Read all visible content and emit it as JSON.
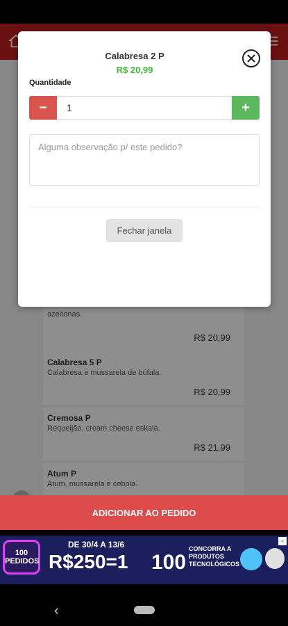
{
  "modal": {
    "title": "Calabresa 2 P",
    "price": "R$ 20,99",
    "quantity_label": "Quantidade",
    "quantity_value": "1",
    "minus_label": "−",
    "plus_label": "+",
    "observation_placeholder": "Alguma observação p/ este pedido?",
    "close_button_label": "Fechar janela"
  },
  "menu_items": [
    {
      "desc": "azeitonas.",
      "price": "R$ 20,99"
    },
    {
      "name": "Calabresa 5 P",
      "desc": "Calabresa e mussarela de búfala.",
      "price": "R$ 20,99"
    },
    {
      "name": "Cremosa P",
      "desc": "Requeijão, cream cheese eskala.",
      "price": "R$ 21,99"
    },
    {
      "name": "Atum P",
      "desc": "Atum, mussarela e cebola."
    }
  ],
  "add_to_order_label": "ADICIONAR AO PEDIDO",
  "ad": {
    "logo_text": "100 PEDIDOS",
    "dates": "DE 30/4 A 13/6",
    "big_text": "R$250=1",
    "cem": "100",
    "sub_text": "CONCORRA A PRODUTOS TECNOLÓGICOS"
  },
  "colors": {
    "accent_red": "#dd4b4b",
    "appbar_red": "#b71c1c",
    "price_green": "#43b33f",
    "plus_green": "#5cb85c",
    "minus_red": "#d9534f"
  }
}
